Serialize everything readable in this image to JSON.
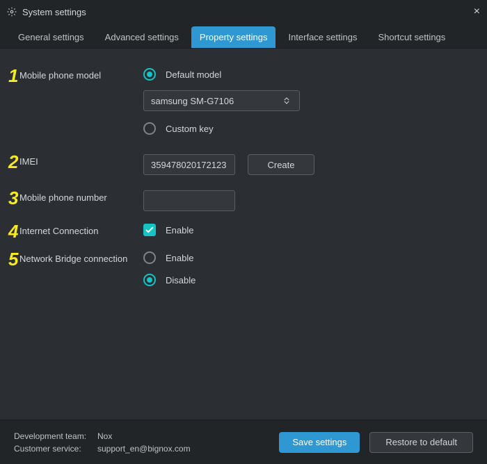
{
  "window": {
    "title": "System settings"
  },
  "tabs": {
    "general": "General settings",
    "advanced": "Advanced settings",
    "property": "Property settings",
    "interface": "Interface settings",
    "shortcut": "Shortcut settings",
    "active": "property"
  },
  "steps": {
    "phone_model": {
      "num": "1",
      "label": "Mobile phone model",
      "default_model": "Default model",
      "custom_key": "Custom key",
      "select_value": "samsung SM-G7106"
    },
    "imei": {
      "num": "2",
      "label": "IMEI",
      "value": "359478020172123",
      "create": "Create"
    },
    "phone_number": {
      "num": "3",
      "label": "Mobile phone number",
      "value": ""
    },
    "internet": {
      "num": "4",
      "label": "Internet Connection",
      "enable": "Enable"
    },
    "bridge": {
      "num": "5",
      "label": "Network Bridge connection",
      "enable": "Enable",
      "disable": "Disable"
    }
  },
  "footer": {
    "dev_team_k": "Development team:",
    "dev_team_v": "Nox",
    "support_k": "Customer service:",
    "support_v": "support_en@bignox.com",
    "save": "Save settings",
    "restore": "Restore to default"
  }
}
